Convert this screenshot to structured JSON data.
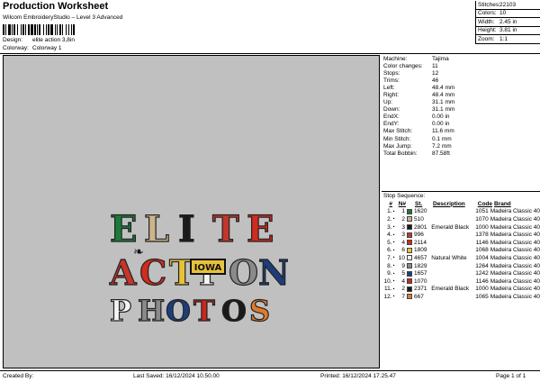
{
  "header": {
    "title": "Production Worksheet",
    "subtitle": "Wilcom EmbroideryStudio – Level 3 Advanced",
    "design_label": "Design:",
    "design_value": "elite action 3,8in",
    "colorway_label": "Colorway:",
    "colorway_value": "Colorway 1"
  },
  "stats": [
    {
      "label": "Stitches:",
      "value": "22103"
    },
    {
      "label": "Colors:",
      "value": "10"
    },
    {
      "label": "Width:",
      "value": "2.45 in"
    },
    {
      "label": "Height:",
      "value": "3.81 in"
    },
    {
      "label": "Zoom:",
      "value": "1:1"
    }
  ],
  "machine_info": [
    {
      "label": "Machine:",
      "value": "Tajima"
    },
    {
      "label": "Color changes:",
      "value": "11"
    },
    {
      "label": "Stops:",
      "value": "12"
    },
    {
      "label": "Trims:",
      "value": "46"
    },
    {
      "label": "Left:",
      "value": "48.4 mm"
    },
    {
      "label": "Right:",
      "value": "48.4 mm"
    },
    {
      "label": "Up:",
      "value": "31.1 mm"
    },
    {
      "label": "Down:",
      "value": "31.1 mm"
    },
    {
      "label": "EndX:",
      "value": "0.00 in"
    },
    {
      "label": "EndY:",
      "value": "0.00 in"
    },
    {
      "label": "Max Stitch:",
      "value": "11.6 mm"
    },
    {
      "label": "Min Stitch:",
      "value": "0.1 mm"
    },
    {
      "label": "Max Jump:",
      "value": "7.2 mm"
    },
    {
      "label": "Total Bobbin:",
      "value": "87.58ft"
    }
  ],
  "sequence": {
    "title": "Stop Sequence:",
    "headers": {
      "index": "#",
      "n": "N#",
      "st": "St.",
      "description": "Description",
      "code": "Code",
      "brand": "Brand"
    },
    "rows": [
      {
        "i": "1.",
        "n": "1",
        "color": "#1e7a3a",
        "st": "1620",
        "desc": "",
        "code": "1051",
        "brand": "Madeira Classic 40"
      },
      {
        "i": "2.",
        "n": "2",
        "color": "#cdb48a",
        "st": "510",
        "desc": "",
        "code": "1070",
        "brand": "Madeira Classic 40"
      },
      {
        "i": "3.",
        "n": "3",
        "color": "#1a1a1a",
        "st": "2801",
        "desc": "Emerald Black",
        "code": "1000",
        "brand": "Madeira Classic 40"
      },
      {
        "i": "4.",
        "n": "3",
        "color": "#c2362c",
        "st": "996",
        "desc": "",
        "code": "1378",
        "brand": "Madeira Classic 40"
      },
      {
        "i": "5.",
        "n": "4",
        "color": "#d12a1f",
        "st": "2114",
        "desc": "",
        "code": "1146",
        "brand": "Madeira Classic 40"
      },
      {
        "i": "6.",
        "n": "6",
        "color": "#e8c23a",
        "st": "1809",
        "desc": "",
        "code": "1068",
        "brand": "Madeira Classic 40"
      },
      {
        "i": "7.",
        "n": "10",
        "color": "#f5f5f5",
        "st": "4657",
        "desc": "Natural White",
        "code": "1004",
        "brand": "Madeira Classic 40"
      },
      {
        "i": "8.",
        "n": "9",
        "color": "#8a8a8a",
        "st": "1829",
        "desc": "",
        "code": "1264",
        "brand": "Madeira Classic 40"
      },
      {
        "i": "9.",
        "n": "5",
        "color": "#1c3f7a",
        "st": "1657",
        "desc": "",
        "code": "1242",
        "brand": "Madeira Classic 40"
      },
      {
        "i": "10.",
        "n": "4",
        "color": "#c8281e",
        "st": "1070",
        "desc": "",
        "code": "1146",
        "brand": "Madeira Classic 40"
      },
      {
        "i": "11.",
        "n": "2",
        "color": "#1a1a1a",
        "st": "2371",
        "desc": "Emerald Black",
        "code": "1000",
        "brand": "Madeira Classic 40"
      },
      {
        "i": "12.",
        "n": "7",
        "color": "#e07a2a",
        "st": "667",
        "desc": "",
        "code": "1065",
        "brand": "Madeira Classic 40"
      }
    ]
  },
  "design_art": {
    "line1": [
      "E",
      "L",
      "I",
      "T",
      "E"
    ],
    "line2": [
      "A",
      "C",
      "T",
      "I",
      "O",
      "N"
    ],
    "line3": [
      "P",
      "H",
      "O",
      "T",
      "O",
      "S"
    ],
    "badge": "IOWA",
    "hawk": "❧"
  },
  "footer": {
    "created_by": "Created By:",
    "last_saved": "Last Saved: 16/12/2024 10.50.00",
    "printed": "Printed: 16/12/2024 17.25.47",
    "page": "Page 1 of 1"
  }
}
